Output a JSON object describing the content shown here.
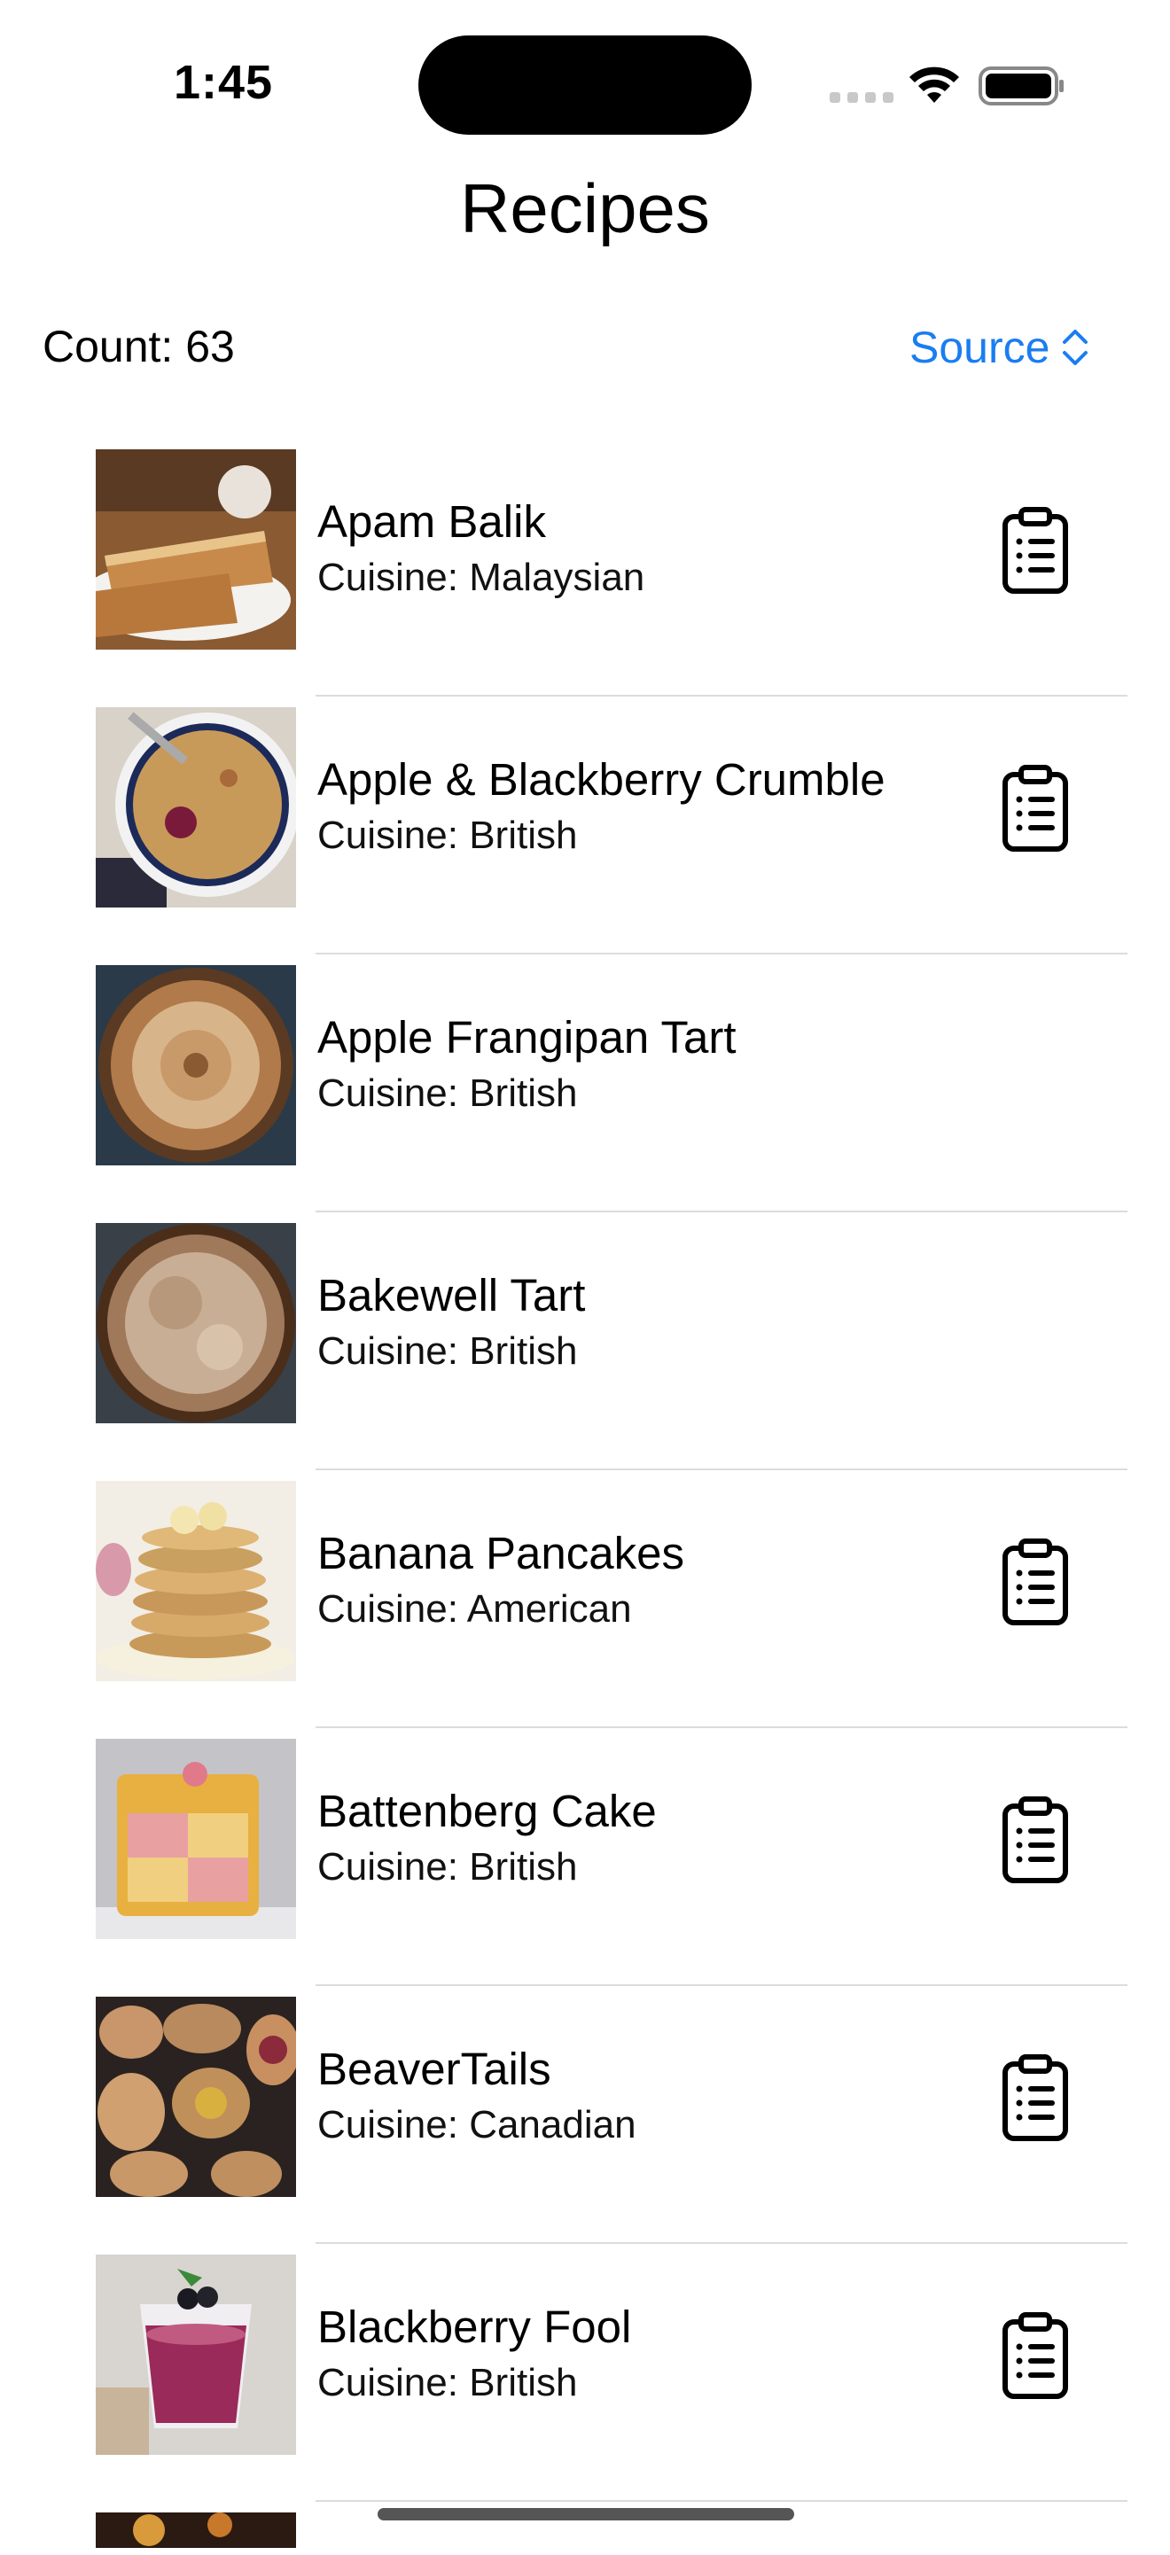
{
  "status_bar": {
    "time": "1:45"
  },
  "nav": {
    "title": "Recipes"
  },
  "toolbar": {
    "count_label": "Count: 63",
    "source_label": "Source",
    "accent_color": "#1a7df1"
  },
  "recipes": [
    {
      "name": "Apam Balik",
      "cuisine": "Cuisine: Malaysian",
      "has_recipe_icon": true
    },
    {
      "name": "Apple & Blackberry Crumble",
      "cuisine": "Cuisine: British",
      "has_recipe_icon": true
    },
    {
      "name": "Apple Frangipan Tart",
      "cuisine": "Cuisine: British",
      "has_recipe_icon": false
    },
    {
      "name": "Bakewell Tart",
      "cuisine": "Cuisine: British",
      "has_recipe_icon": false
    },
    {
      "name": "Banana Pancakes",
      "cuisine": "Cuisine: American",
      "has_recipe_icon": true
    },
    {
      "name": "Battenberg Cake",
      "cuisine": "Cuisine: British",
      "has_recipe_icon": true
    },
    {
      "name": "BeaverTails",
      "cuisine": "Cuisine: Canadian",
      "has_recipe_icon": true
    },
    {
      "name": "Blackberry Fool",
      "cuisine": "Cuisine: British",
      "has_recipe_icon": true
    }
  ],
  "icons": {
    "recipe_icon": "clipboard-list-icon",
    "source_icon": "chevron-up-down-icon"
  }
}
